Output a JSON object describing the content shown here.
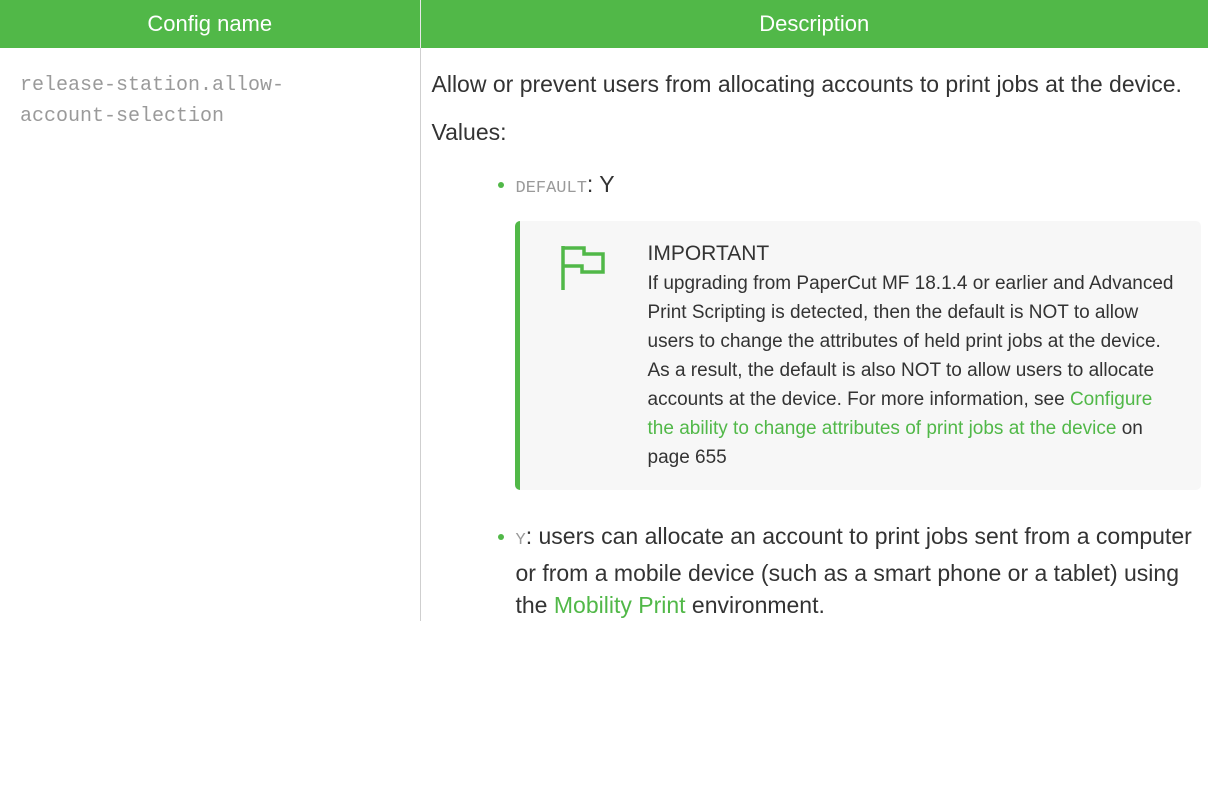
{
  "table": {
    "header_config_name": "Config name",
    "header_description": "Description"
  },
  "row": {
    "config_name_line1": "release-station.allow-",
    "config_name_line2": "account-selection",
    "description_intro": "Allow or prevent users from allocating accounts to print jobs at the device.",
    "values_label": "Values:",
    "default_key": "DEFAULT",
    "default_sep": ":",
    "default_value": "Y",
    "note": {
      "icon": "flag-icon",
      "title": "IMPORTANT",
      "body_text": "If upgrading from PaperCut MF 18.1.4 or earlier and Advanced Print Scripting is detected, then the default is NOT to allow users to change the attributes of held print jobs at the device. As a result, the default is also NOT to allow users to allocate accounts at the device. For more information, see ",
      "link_text": "Configure the ability to change attributes of print jobs at the device",
      "page_ref": " on page 655"
    },
    "y_key": "Y",
    "y_text_before": ": users can allocate an account to print jobs sent from a computer or from a mobile device (such as a smart phone or a tablet) using the ",
    "y_link_text": "Mobility Print",
    "y_text_after": " environment."
  },
  "colors": {
    "accent": "#51b848",
    "text": "#333333",
    "mono_text": "#9a9a9a",
    "note_bg": "#f7f7f7"
  }
}
